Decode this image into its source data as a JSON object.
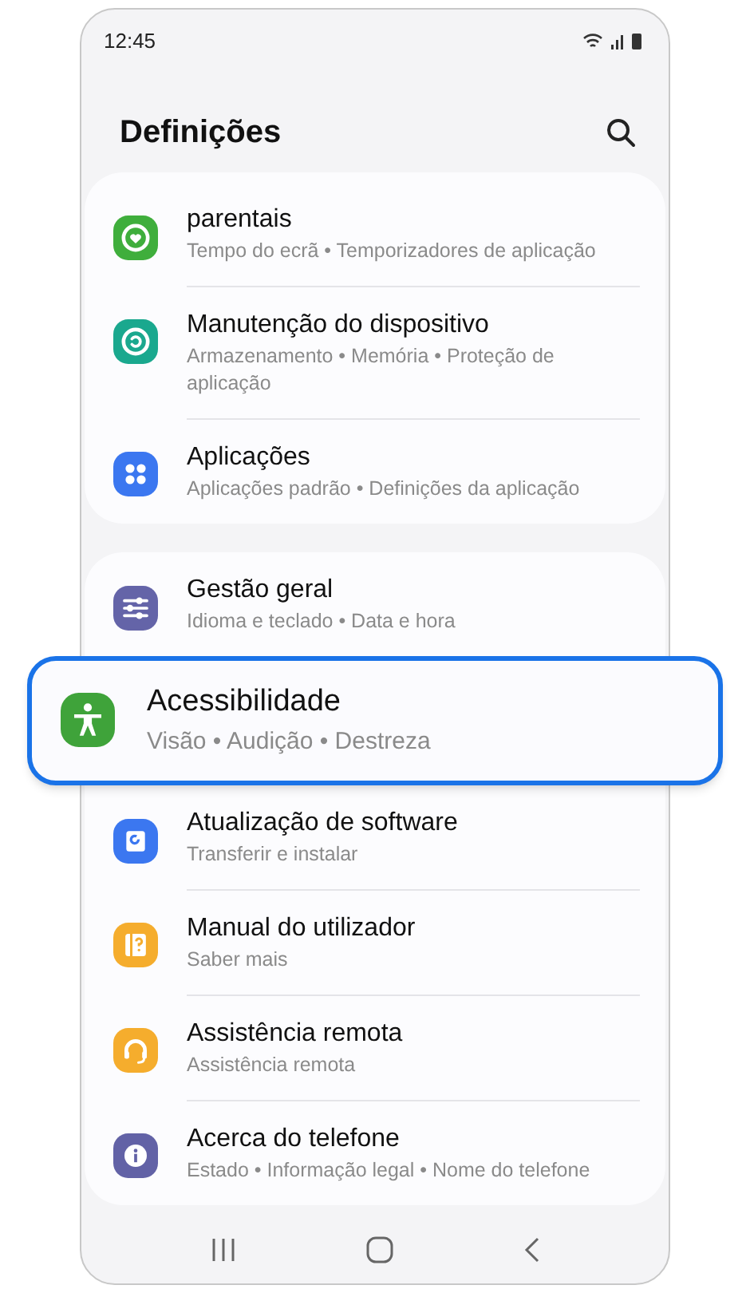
{
  "status_bar": {
    "time": "12:45"
  },
  "header": {
    "title": "Definições"
  },
  "groups": [
    {
      "items": [
        {
          "title": "parentais",
          "subtitle": "Tempo do ecrã • Temporizadores de aplicação",
          "kind": "heart",
          "color": "#3fae3c",
          "highlighted": false
        },
        {
          "title": "Manutenção do dispositivo",
          "subtitle": "Armazenamento • Memória • Proteção de aplicação",
          "kind": "refresh",
          "color": "#1aa88e",
          "highlighted": false
        },
        {
          "title": "Aplicações",
          "subtitle": "Aplicações padrão • Definições da aplicação",
          "kind": "dots",
          "color": "#3b77f0",
          "highlighted": false
        }
      ]
    },
    {
      "items": [
        {
          "title": "Gestão geral",
          "subtitle": "Idioma e teclado • Data e hora",
          "kind": "sliders",
          "color": "#6464a8",
          "highlighted": false
        },
        {
          "title": "Acessibilidade",
          "subtitle": "Visão • Audição • Destreza",
          "kind": "person",
          "color": "#3fa33a",
          "highlighted": true
        },
        {
          "title": "Atualização de software",
          "subtitle": "Transferir e instalar",
          "kind": "update",
          "color": "#3b77f0",
          "highlighted": false
        },
        {
          "title": "Manual do utilizador",
          "subtitle": "Saber mais",
          "kind": "manual",
          "color": "#f5ad2d",
          "highlighted": false
        },
        {
          "title": "Assistência remota",
          "subtitle": "Assistência remota",
          "kind": "headset",
          "color": "#f5ad2d",
          "highlighted": false
        },
        {
          "title": "Acerca do telefone",
          "subtitle": "Estado • Informação legal • Nome do telefone",
          "kind": "info",
          "color": "#6262a6",
          "highlighted": false
        }
      ]
    }
  ]
}
